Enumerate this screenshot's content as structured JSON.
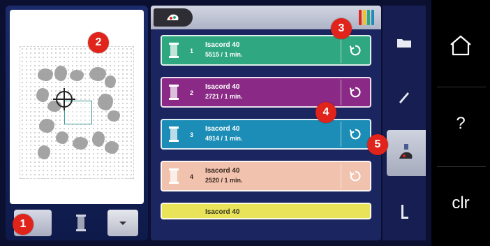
{
  "badges": [
    "1",
    "2",
    "3",
    "4",
    "5"
  ],
  "color_list": {
    "rows": [
      {
        "number": "1",
        "name": "Isacord 40",
        "detail": "5515 / 1 min.",
        "color": "#2fa781"
      },
      {
        "number": "2",
        "name": "Isacord 40",
        "detail": "2721 / 1 min.",
        "color": "#8a2a86"
      },
      {
        "number": "3",
        "name": "Isacord 40",
        "detail": "4914 / 1 min.",
        "color": "#1b8db6"
      },
      {
        "number": "4",
        "name": "Isacord 40",
        "detail": "2520 / 1 min.",
        "color": "#f1c2ad"
      },
      {
        "number": "",
        "name": "Isacord 40",
        "detail": "",
        "color": "#e9e35a"
      }
    ]
  },
  "system": {
    "home_icon": "home-icon",
    "help_label": "?",
    "clear_label": "clr"
  },
  "nav_icons": [
    "folder-icon",
    "needle-icon",
    "color-info-icon",
    "stitch-icon"
  ],
  "colors": {
    "badge": "#e0241b",
    "panel_blue": "#1b2560",
    "frame_bg": "#0b1030"
  }
}
